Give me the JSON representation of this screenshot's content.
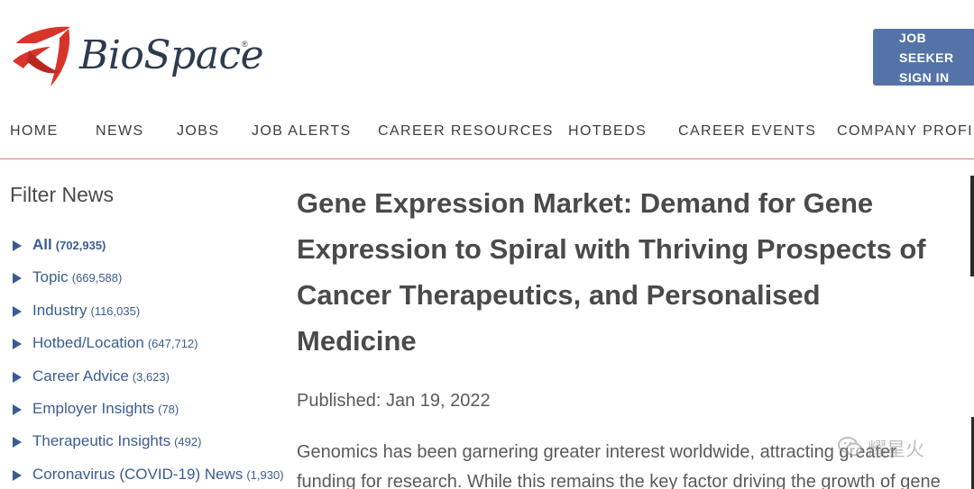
{
  "header": {
    "logo_text": "BioSpace",
    "logo_reg": "®",
    "signin_line1": "JOB SEEKER",
    "signin_line2": "SIGN IN"
  },
  "nav": {
    "items": [
      "HOME",
      "NEWS",
      "JOBS",
      "JOB ALERTS",
      "CAREER RESOURCES",
      "HOTBEDS",
      "CAREER EVENTS",
      "COMPANY PROFILE"
    ]
  },
  "sidebar": {
    "title": "Filter News",
    "items": [
      {
        "label": "All",
        "count": "(702,935)"
      },
      {
        "label": "Topic",
        "count": "(669,588)"
      },
      {
        "label": "Industry",
        "count": "(116,035)"
      },
      {
        "label": "Hotbed/Location",
        "count": "(647,712)"
      },
      {
        "label": "Career Advice",
        "count": "(3,623)"
      },
      {
        "label": "Employer Insights",
        "count": "(78)"
      },
      {
        "label": "Therapeutic Insights",
        "count": "(492)"
      },
      {
        "label": "Coronavirus (COVID-19) News",
        "count": "(1,930)"
      }
    ]
  },
  "article": {
    "title": "Gene Expression Market: Demand for Gene Expression to Spiral with Thriving Prospects of Cancer Therapeutics, and Personalised Medicine",
    "published": "Published: Jan 19, 2022",
    "body": "Genomics has been garnering greater interest worldwide, attracting greater funding for research. While this remains the key factor driving the growth of gene"
  },
  "watermark": {
    "text": "耀星火",
    "icon": "wechat-icon"
  },
  "colors": {
    "brand_red": "#d9342b",
    "brand_navy": "#2e3b4e",
    "link_blue": "#3b5c93",
    "button_blue": "#5474a8",
    "nav_rule": "#d97a7a"
  }
}
